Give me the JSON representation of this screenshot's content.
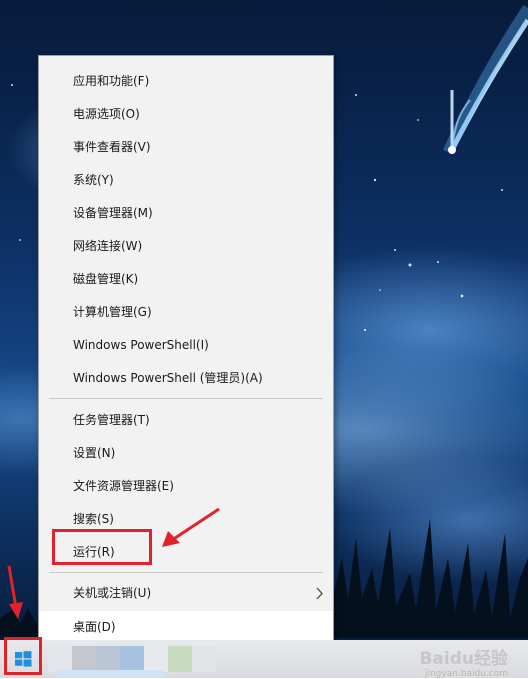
{
  "context_menu": {
    "items": [
      {
        "label": "应用和功能(F)"
      },
      {
        "label": "电源选项(O)"
      },
      {
        "label": "事件查看器(V)"
      },
      {
        "label": "系统(Y)"
      },
      {
        "label": "设备管理器(M)"
      },
      {
        "label": "网络连接(W)"
      },
      {
        "label": "磁盘管理(K)"
      },
      {
        "label": "计算机管理(G)"
      },
      {
        "label": "Windows PowerShell(I)"
      },
      {
        "label": "Windows PowerShell (管理员)(A)"
      },
      {
        "label": "任务管理器(T)"
      },
      {
        "label": "设置(N)"
      },
      {
        "label": "文件资源管理器(E)"
      },
      {
        "label": "搜索(S)"
      },
      {
        "label": "运行(R)"
      },
      {
        "label": "关机或注销(U)"
      },
      {
        "label": "桌面(D)"
      }
    ]
  },
  "watermark": {
    "logo": "Baidu经验",
    "url": "jingyan.baidu.com"
  },
  "colors": {
    "highlight_red": "#e0232a",
    "menu_bg": "#f2f2f2",
    "start_blue": "#1e90e0"
  },
  "icons": [
    "windows-start-icon",
    "submenu-chevron-icon"
  ]
}
